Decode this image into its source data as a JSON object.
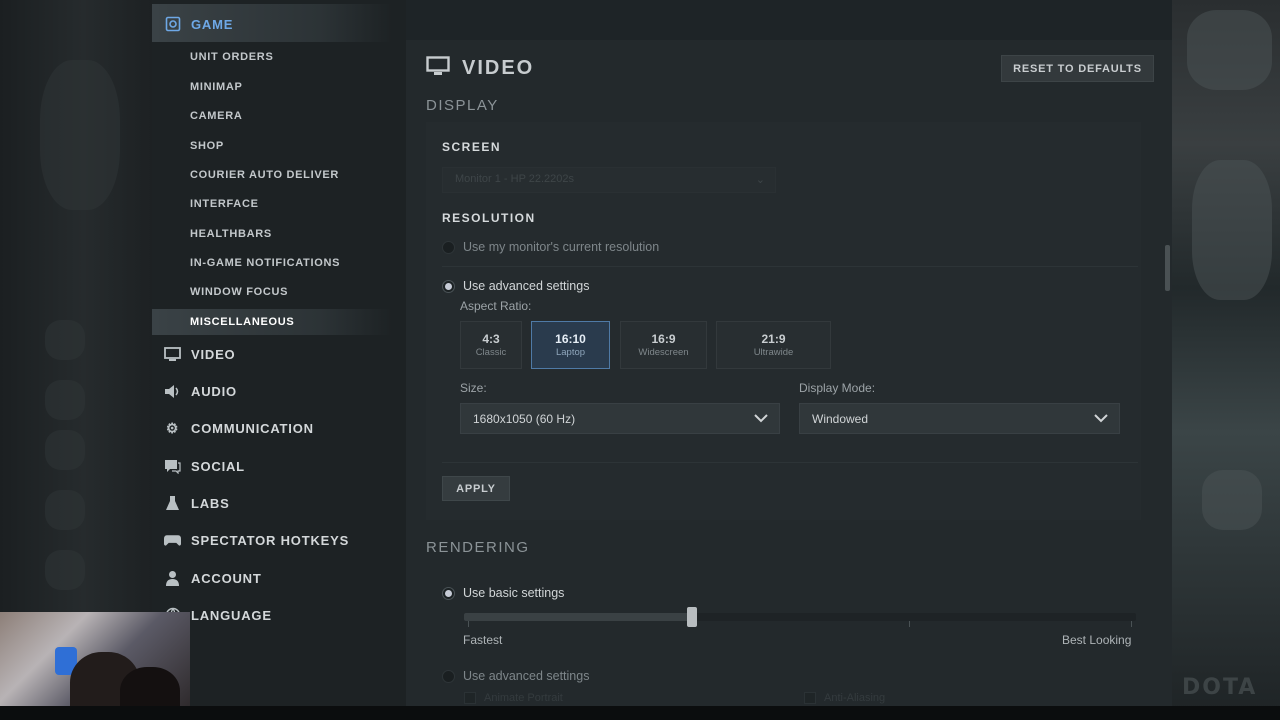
{
  "sidebar": {
    "game_label": "GAME",
    "game_items": [
      {
        "label": "UNIT ORDERS"
      },
      {
        "label": "MINIMAP"
      },
      {
        "label": "CAMERA"
      },
      {
        "label": "SHOP"
      },
      {
        "label": "COURIER AUTO DELIVER"
      },
      {
        "label": "INTERFACE"
      },
      {
        "label": "HEALTHBARS"
      },
      {
        "label": "IN-GAME NOTIFICATIONS"
      },
      {
        "label": "WINDOW FOCUS"
      },
      {
        "label": "MISCELLANEOUS"
      }
    ],
    "sections": [
      {
        "label": "VIDEO",
        "icon": "monitor-icon"
      },
      {
        "label": "AUDIO",
        "icon": "speaker-icon"
      },
      {
        "label": "COMMUNICATION",
        "icon": "gear-icon"
      },
      {
        "label": "SOCIAL",
        "icon": "chat-icon"
      },
      {
        "label": "LABS",
        "icon": "flask-icon"
      },
      {
        "label": "SPECTATOR HOTKEYS",
        "icon": "gamepad-icon"
      },
      {
        "label": "ACCOUNT",
        "icon": "user-icon"
      },
      {
        "label": "LANGUAGE",
        "icon": "globe-icon"
      }
    ],
    "selected_item": "MISCELLANEOUS"
  },
  "main": {
    "title": "VIDEO",
    "reset_label": "RESET TO DEFAULTS",
    "display": {
      "category": "DISPLAY",
      "screen_heading": "SCREEN",
      "screen_value": "Monitor 1 - HP 22.2202s",
      "resolution_heading": "RESOLUTION",
      "option_current": "Use my monitor's current resolution",
      "option_advanced": "Use advanced settings",
      "aspect_label": "Aspect Ratio:",
      "aspect_ratios": [
        {
          "ratio": "4:3",
          "name": "Classic"
        },
        {
          "ratio": "16:10",
          "name": "Laptop"
        },
        {
          "ratio": "16:9",
          "name": "Widescreen"
        },
        {
          "ratio": "21:9",
          "name": "Ultrawide"
        }
      ],
      "selected_aspect": "16:10",
      "size_label": "Size:",
      "size_value": "1680x1050 (60 Hz)",
      "mode_label": "Display Mode:",
      "mode_value": "Windowed",
      "apply_label": "APPLY"
    },
    "rendering": {
      "category": "RENDERING",
      "option_basic": "Use basic settings",
      "quality_level": 0.34,
      "slider_min_label": "Fastest",
      "slider_max_label": "Best Looking",
      "option_advanced": "Use advanced settings",
      "check_1": "Animate Portrait",
      "check_2": "Anti-Aliasing"
    }
  },
  "colors": {
    "accent": "#6ea8e6",
    "selected_ratio_bg": "#2a3b4d",
    "panel_bg": "#23292c",
    "sidebar_bg": "#1d2224"
  }
}
